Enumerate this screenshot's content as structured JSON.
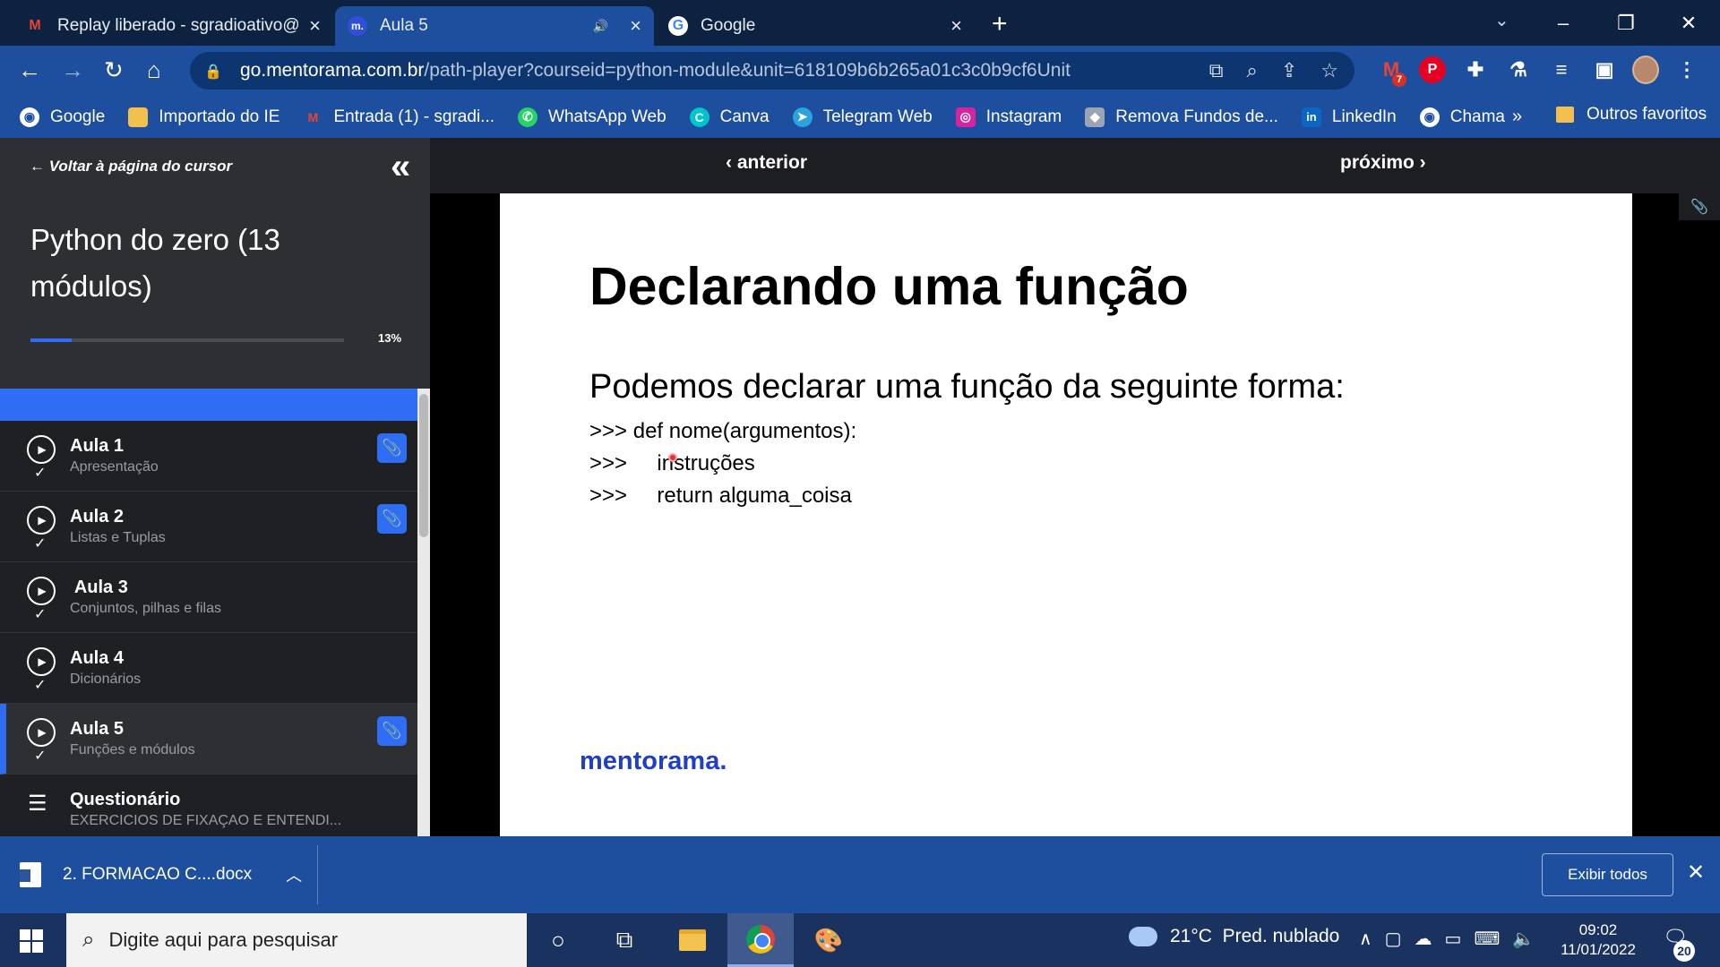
{
  "browser": {
    "tabs": [
      {
        "title": "Replay liberado - sgradioativo@g",
        "favicon": "gmail-icon",
        "active": false
      },
      {
        "title": "Aula 5",
        "favicon": "mentorama-icon",
        "active": true,
        "audio": true
      },
      {
        "title": "Google",
        "favicon": "google-icon",
        "active": false
      }
    ],
    "url_domain": "go.mentorama.com.br",
    "url_path": "/path-player?courseid=python-module&unit=618109b6b265a01c3c0b9cf6Unit",
    "gmail_badge": "7",
    "bookmarks": [
      {
        "label": "Google",
        "icon": "globe-icon",
        "color": "#ffffff"
      },
      {
        "label": "Importado do IE",
        "icon": "folder-icon",
        "color": "#f2c04c"
      },
      {
        "label": "Entrada (1) - sgradi...",
        "icon": "gmail-icon",
        "color": "#ea4335"
      },
      {
        "label": "WhatsApp Web",
        "icon": "whatsapp-icon",
        "color": "#25d366"
      },
      {
        "label": "Canva",
        "icon": "canva-icon",
        "color": "#00c4cc"
      },
      {
        "label": "Telegram Web",
        "icon": "telegram-icon",
        "color": "#2aa3df"
      },
      {
        "label": "Instagram",
        "icon": "instagram-icon",
        "color": "#d6249f"
      },
      {
        "label": "Remova Fundos de...",
        "icon": "removebg-icon",
        "color": "#9aa4b2"
      },
      {
        "label": "LinkedIn",
        "icon": "linkedin-icon",
        "color": "#0a66c2"
      },
      {
        "label": "Chama",
        "icon": "globe-icon",
        "color": "#ffffff"
      }
    ],
    "bookmarks_more": "»",
    "other_bookmarks": "Outros favoritos"
  },
  "sidebar": {
    "back_link": "← Voltar à página do cursor",
    "course_title": "Python do zero (13 módulos)",
    "progress_label": "13%",
    "progress_value": 0.13,
    "lessons": [
      {
        "title": "Aula 1",
        "subtitle": "Apresentação",
        "has_attachment": true,
        "current": false
      },
      {
        "title": "Aula 2",
        "subtitle": "Listas e Tuplas",
        "has_attachment": true,
        "current": false
      },
      {
        "title": " Aula 3",
        "subtitle": "Conjuntos, pilhas e filas",
        "has_attachment": false,
        "current": false
      },
      {
        "title": "Aula 4",
        "subtitle": "Dicionários",
        "has_attachment": false,
        "current": false
      },
      {
        "title": "Aula 5",
        "subtitle": "Funções e módulos",
        "has_attachment": true,
        "current": true
      }
    ],
    "quiz": {
      "title": "Questionário",
      "subtitle": "EXERCICIOS DE FIXAÇAO E ENTENDI..."
    }
  },
  "player": {
    "prev_label": "‹ anterior",
    "next_label": "próximo ›"
  },
  "slide": {
    "title": "Declarando uma função",
    "lead": "Podemos declarar uma função da seguinte forma:",
    "code": [
      ">>> def nome(argumentos):",
      ">>>     instruções",
      ">>>     return alguma_coisa"
    ],
    "brand": "mentorama."
  },
  "downloads": {
    "file": "2. FORMACAO C....docx",
    "show_all": "Exibir todos"
  },
  "taskbar": {
    "search_placeholder": "Digite aqui para pesquisar",
    "weather": "21°C  Pred. nublado",
    "time": "09:02",
    "date": "11/01/2022",
    "notifications": "20"
  }
}
